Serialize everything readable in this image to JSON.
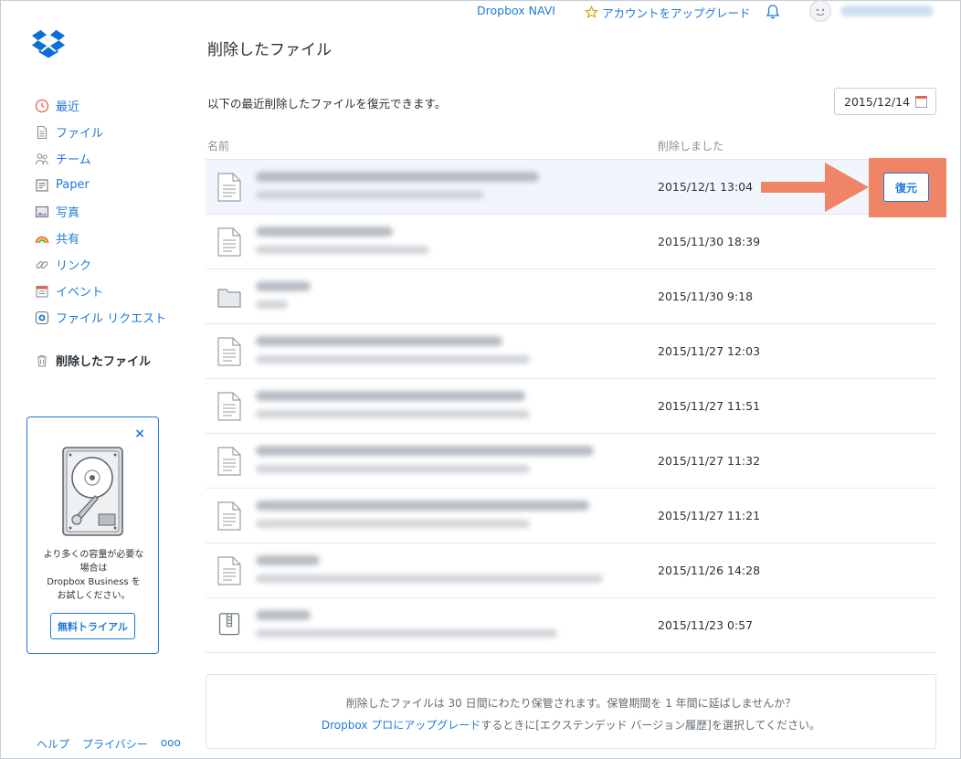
{
  "topbar": {
    "navi_link": "Dropbox NAVI",
    "upgrade_link": "アカウントをアップグレード"
  },
  "sidebar": {
    "items": [
      {
        "label": "最近",
        "icon": "clock-icon"
      },
      {
        "label": "ファイル",
        "icon": "file-icon"
      },
      {
        "label": "チーム",
        "icon": "team-icon"
      },
      {
        "label": "Paper",
        "icon": "paper-icon"
      },
      {
        "label": "写真",
        "icon": "photo-icon"
      },
      {
        "label": "共有",
        "icon": "rainbow-icon"
      },
      {
        "label": "リンク",
        "icon": "link-icon"
      },
      {
        "label": "イベント",
        "icon": "calendar-icon"
      },
      {
        "label": "ファイル リクエスト",
        "icon": "request-icon"
      }
    ],
    "active_item": "削除したファイル",
    "promo": {
      "close": "×",
      "line1": "より多くの容量が必要な",
      "line2": "場合は",
      "line3": "Dropbox Business を",
      "line4": "お試しください。",
      "button": "無料トライアル"
    },
    "footer": {
      "help": "ヘルプ",
      "privacy": "プライバシー",
      "more": "ooo"
    }
  },
  "main": {
    "title": "削除したファイル",
    "subtitle": "以下の最近削除したファイルを復元できます。",
    "date_filter": "2015/12/14",
    "columns": {
      "name": "名前",
      "deleted": "削除しました"
    },
    "rows": [
      {
        "type": "file",
        "deleted": "2015/12/1 13:04",
        "selected": true
      },
      {
        "type": "file",
        "deleted": "2015/11/30 18:39"
      },
      {
        "type": "folder",
        "deleted": "2015/11/30 9:18"
      },
      {
        "type": "file",
        "deleted": "2015/11/27 12:03"
      },
      {
        "type": "file",
        "deleted": "2015/11/27 11:51"
      },
      {
        "type": "file",
        "deleted": "2015/11/27 11:32"
      },
      {
        "type": "file",
        "deleted": "2015/11/27 11:21"
      },
      {
        "type": "file",
        "deleted": "2015/11/26 14:28"
      },
      {
        "type": "archive",
        "deleted": "2015/11/23 0:57"
      }
    ],
    "restore_button": "復元",
    "notice": {
      "line1": "削除したファイルは 30 日間にわたり保管されます。保管期間を 1 年間に延ばしませんか？",
      "link": "Dropbox プロにアップグレード",
      "line2_rest": "するときに[エクステンデッド バージョン履歴]を選択してください。"
    }
  },
  "colors": {
    "link": "#1f7ad6",
    "highlight": "#f08467",
    "selected_row": "#f1f6fc"
  }
}
